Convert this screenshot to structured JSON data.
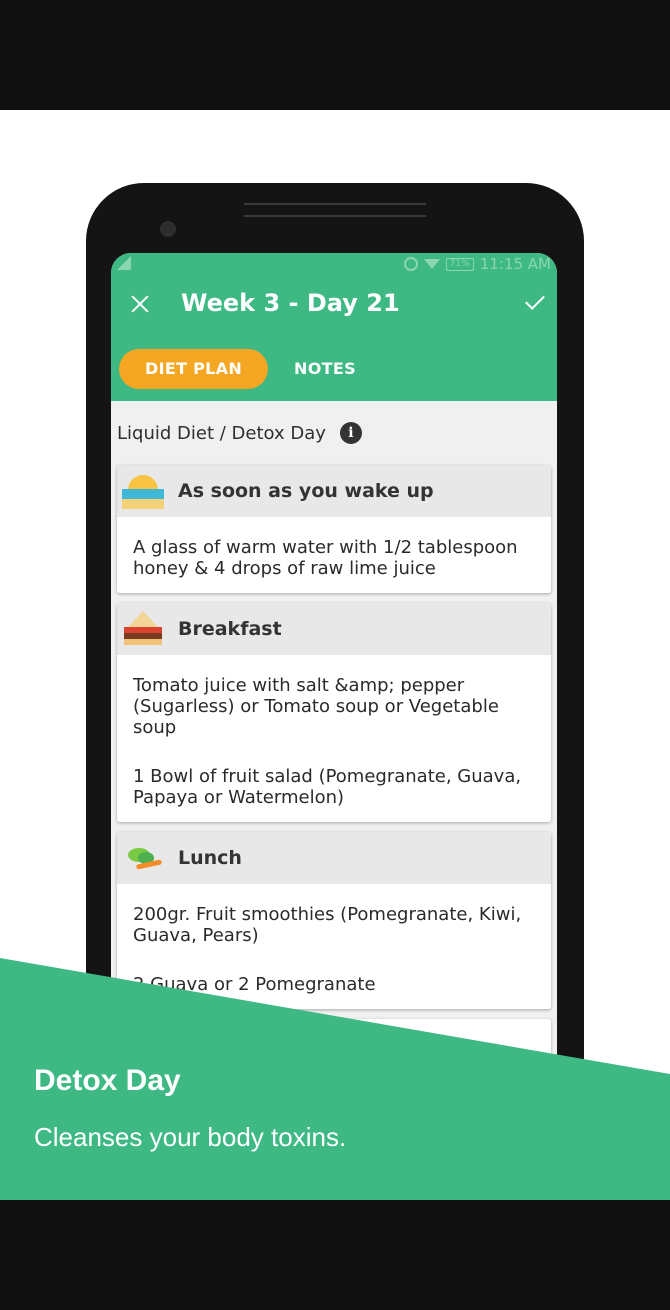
{
  "status_bar": {
    "battery": "71%",
    "time": "11:15 AM"
  },
  "toolbar": {
    "title": "Week 3 - Day 21"
  },
  "tabs": [
    {
      "label": "DIET PLAN",
      "active": true
    },
    {
      "label": "NOTES",
      "active": false
    }
  ],
  "plan_subtitle": "Liquid Diet / Detox Day",
  "meals": [
    {
      "icon": "sunrise-icon",
      "title": "As soon as you wake up",
      "items": [
        "A glass of warm water with 1/2 tablespoon honey & 4 drops of raw lime juice"
      ]
    },
    {
      "icon": "sandwich-icon",
      "title": "Breakfast",
      "items": [
        "Tomato juice with salt &amp; pepper (Sugarless) or Tomato soup or Vegetable soup",
        "1 Bowl of fruit salad (Pomegranate, Guava, Papaya or Watermelon)"
      ]
    },
    {
      "icon": "salad-icon",
      "title": "Lunch",
      "items": [
        "200gr. Fruit smoothies (Pomegranate, Kiwi, Guava, Pears)",
        "2 Guava or 2 Pomegranate"
      ]
    }
  ],
  "banner": {
    "title": "Detox Day",
    "subtitle": "Cleanses your body toxins."
  },
  "colors": {
    "brand_green": "#3fb984",
    "tab_active": "#f5a623",
    "letterbox": "#0f0f0f"
  }
}
